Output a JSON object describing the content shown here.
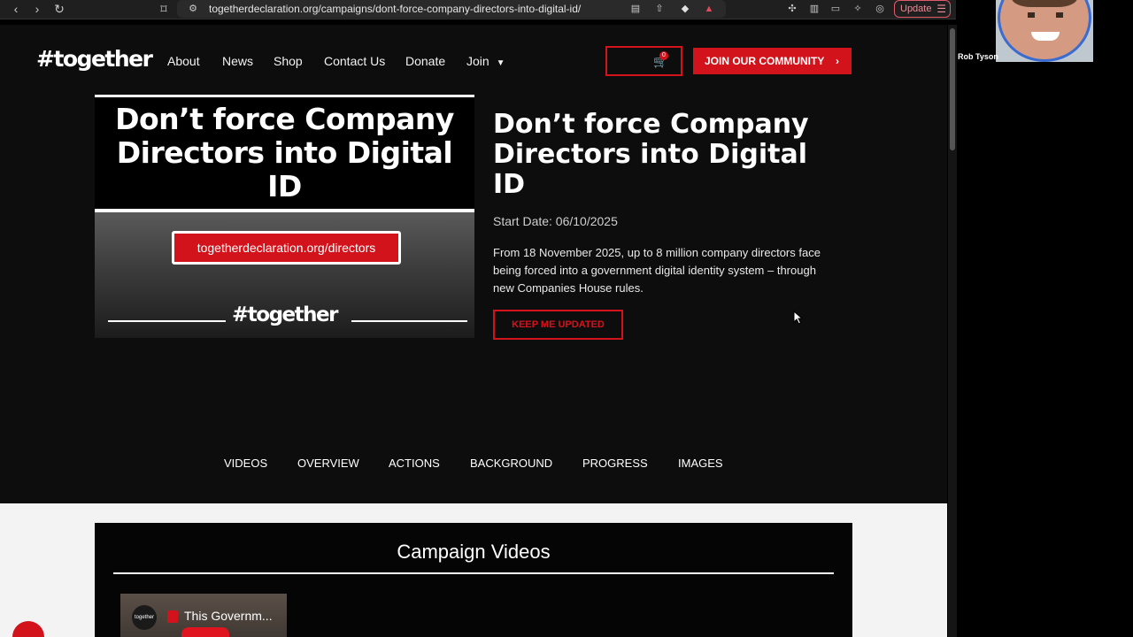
{
  "browser": {
    "url": "togetherdeclaration.org/campaigns/dont-force-company-directors-into-digital-id/",
    "update_label": "Update"
  },
  "header": {
    "logo": "#together",
    "menu": [
      "About",
      "News",
      "Shop",
      "Contact Us",
      "Donate",
      "Join"
    ],
    "cart_count": "0",
    "join_label": "JOIN OUR COMMUNITY"
  },
  "hero": {
    "headline": "Don’t force Company Directors into Digital ID",
    "url_badge": "togetherdeclaration.org/directors",
    "tag": "#together"
  },
  "campaign": {
    "title": "Don’t force Company Directors into Digital ID",
    "start_date": "Start Date: 06/10/2025",
    "description": "From 18 November 2025, up to 8 million company directors face being forced into a government digital identity system – through new Companies House rules.",
    "keep_updated": "KEEP ME UPDATED"
  },
  "tabs": [
    "VIDEOS",
    "OVERVIEW",
    "ACTIONS",
    "BACKGROUND",
    "PROGRESS",
    "IMAGES"
  ],
  "videos": {
    "title": "Campaign Videos",
    "items": [
      {
        "channel": "together",
        "title": "This Governm..."
      }
    ]
  },
  "webcam": {
    "name": "Rob Tyson"
  },
  "colors": {
    "accent": "#d3131b",
    "background": "#0d0d0d"
  },
  "icons": [
    "back-icon",
    "forward-icon",
    "reload-icon",
    "bookmark-icon",
    "site-settings-icon",
    "cart-icon",
    "chevron-down-icon",
    "chevron-right-icon",
    "play-icon"
  ]
}
